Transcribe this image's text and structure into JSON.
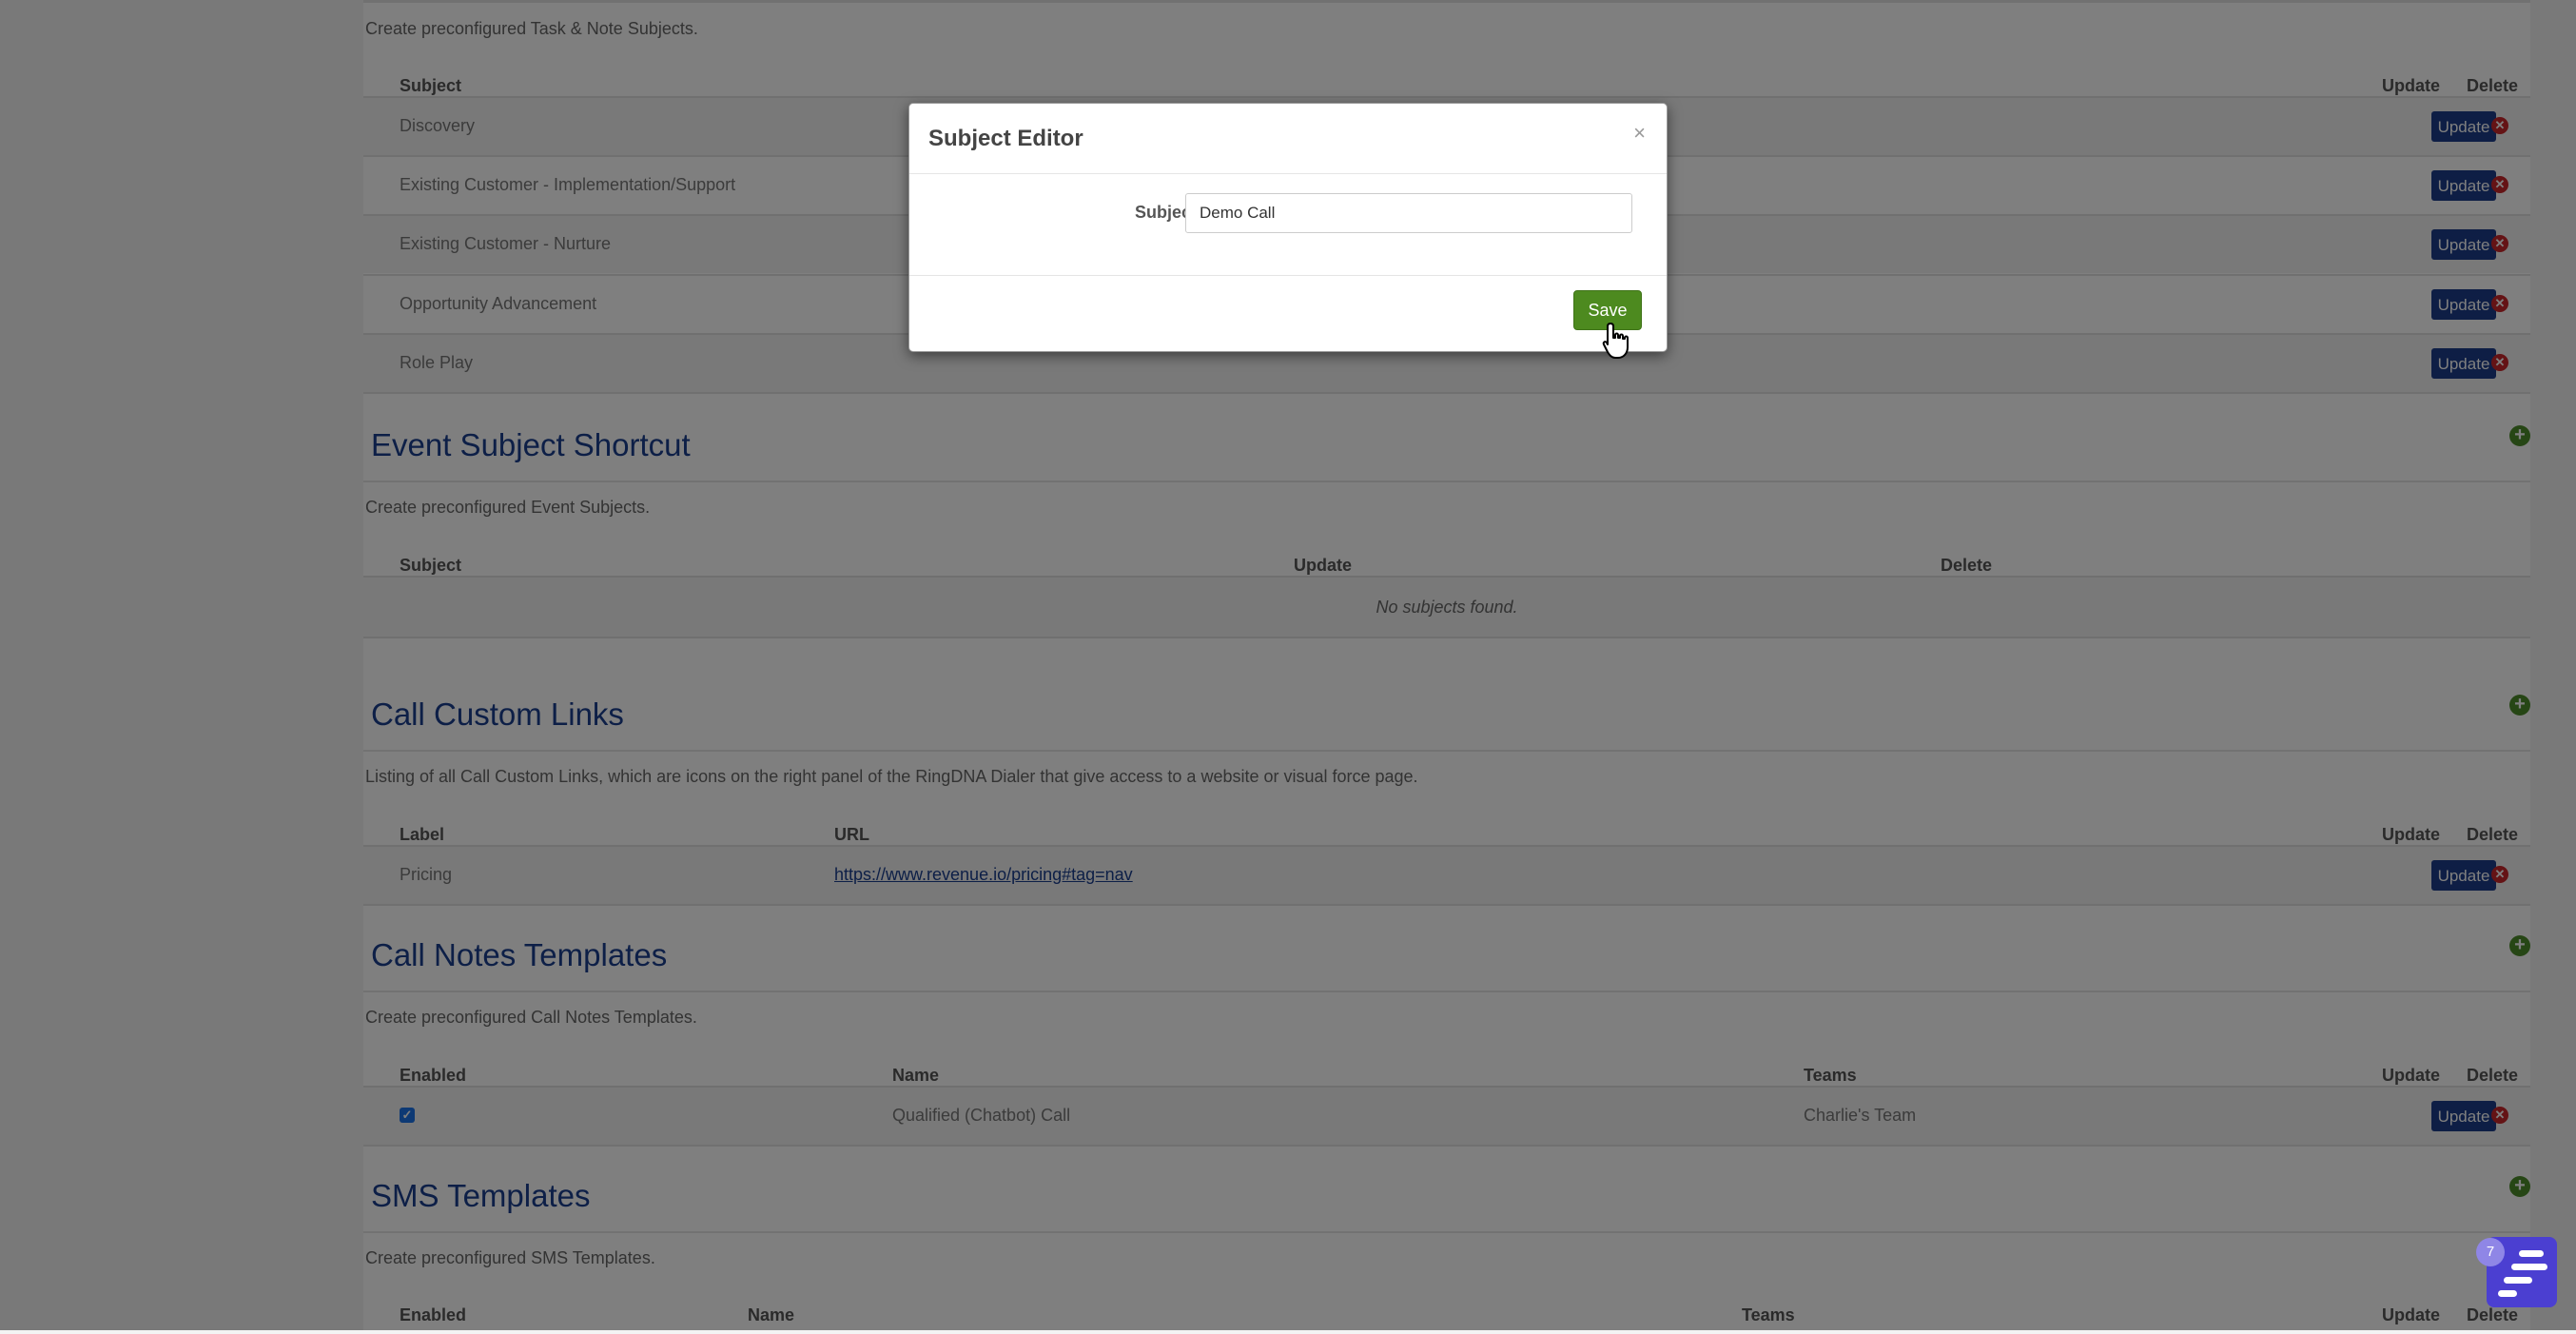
{
  "task_subjects": {
    "description": "Create preconfigured Task & Note Subjects.",
    "headers": {
      "subject": "Subject",
      "update": "Update",
      "delete": "Delete"
    },
    "rows": [
      {
        "subject": "Discovery"
      },
      {
        "subject": "Existing Customer - Implementation/Support"
      },
      {
        "subject": "Existing Customer - Nurture"
      },
      {
        "subject": "Opportunity Advancement"
      },
      {
        "subject": "Role Play"
      }
    ],
    "update_label": "Update"
  },
  "event_subjects": {
    "title": "Event Subject Shortcut",
    "description": "Create preconfigured Event Subjects.",
    "headers": {
      "subject": "Subject",
      "update": "Update",
      "delete": "Delete"
    },
    "empty_text": "No subjects found."
  },
  "call_links": {
    "title": "Call Custom Links",
    "description": "Listing of all Call Custom Links, which are icons on the right panel of the RingDNA Dialer that give access to a website or visual force page.",
    "headers": {
      "label": "Label",
      "url": "URL",
      "update": "Update",
      "delete": "Delete"
    },
    "rows": [
      {
        "label": "Pricing",
        "url": "https://www.revenue.io/pricing#tag=nav"
      }
    ],
    "update_label": "Update"
  },
  "call_notes": {
    "title": "Call Notes Templates",
    "description": "Create preconfigured Call Notes Templates.",
    "headers": {
      "enabled": "Enabled",
      "name": "Name",
      "teams": "Teams",
      "update": "Update",
      "delete": "Delete"
    },
    "rows": [
      {
        "enabled": true,
        "name": "Qualified (Chatbot) Call",
        "teams": "Charlie's Team"
      }
    ],
    "update_label": "Update"
  },
  "sms_templates": {
    "title": "SMS Templates",
    "description": "Create preconfigured SMS Templates.",
    "headers": {
      "enabled": "Enabled",
      "name": "Name",
      "teams": "Teams",
      "update": "Update",
      "delete": "Delete"
    }
  },
  "modal": {
    "title": "Subject Editor",
    "close": "×",
    "subject_label": "Subject",
    "subject_value": "Demo Call",
    "save_label": "Save"
  },
  "chat_widget": {
    "badge": "7"
  },
  "icons": {
    "add": "plus-circle-icon",
    "delete": "x-circle-icon",
    "close": "close-icon",
    "cursor": "hand-pointer-icon"
  },
  "colors": {
    "accent": "#1b3f8f",
    "update_button": "#1c3d8a",
    "save_button": "#4d8a1f",
    "delete_icon": "#c8262b",
    "add_icon": "#4d8c2a"
  }
}
